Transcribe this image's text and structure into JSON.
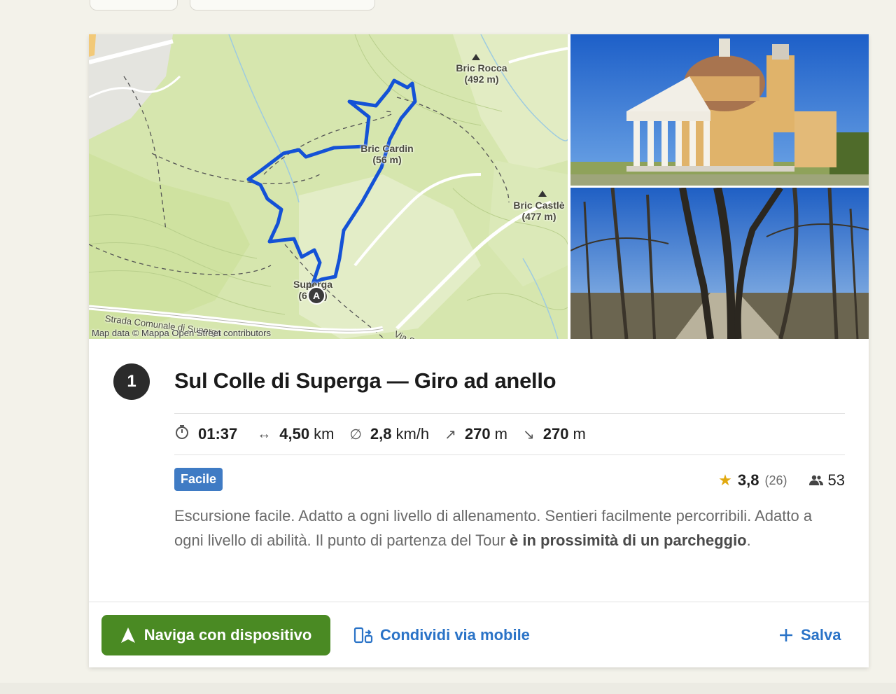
{
  "map": {
    "labels": {
      "bric_rocca": "Bric Rocca",
      "bric_rocca_alt": "(492 m)",
      "bric_cardin": "Bric Cardin",
      "bric_cardin_alt": "(56 m)",
      "bric_castle": "Bric Castlè",
      "bric_castle_alt": "(477 m)",
      "superga": "Superga",
      "superga_alt": "(67 m)",
      "strada": "Strada Comunale di Superga",
      "via": "Via Sup"
    },
    "start_marker": "A",
    "attribution": "Map data © Mappa Open Street contributors",
    "route_color": "#1452d6"
  },
  "tour": {
    "number": "1",
    "title": "Sul Colle di Superga — Giro ad anello",
    "stats": {
      "duration_icon": "stopwatch-icon",
      "duration": "01:37",
      "distance_icon": "horizontal-arrows-icon",
      "distance": "4,50",
      "distance_unit": "km",
      "speed_icon": "average-speed-icon",
      "speed": "2,8",
      "speed_unit": "km/h",
      "ascent_icon": "arrow-up-right-icon",
      "ascent": "270",
      "ascent_unit": "m",
      "descent_icon": "arrow-down-right-icon",
      "descent": "270",
      "descent_unit": "m"
    },
    "difficulty": "Facile",
    "rating": "3,8",
    "rating_count": "(26)",
    "participants": "53",
    "description_1": "Escursione facile. Adatto a ogni livello di allenamento. Sentieri facilmente percorribili. Adatto a ogni livello di abilità. Il punto di partenza del Tour ",
    "description_bold_1": "è in prossimità di un parcheggio",
    "description_2": "."
  },
  "actions": {
    "navigate": "Naviga con dispositivo",
    "share": "Condividi via mobile",
    "save": "Salva"
  },
  "colors": {
    "primary_green": "#4a8a23",
    "link_blue": "#2a73c7",
    "difficulty_blue": "#3f7bc4",
    "star": "#e1a90f"
  }
}
